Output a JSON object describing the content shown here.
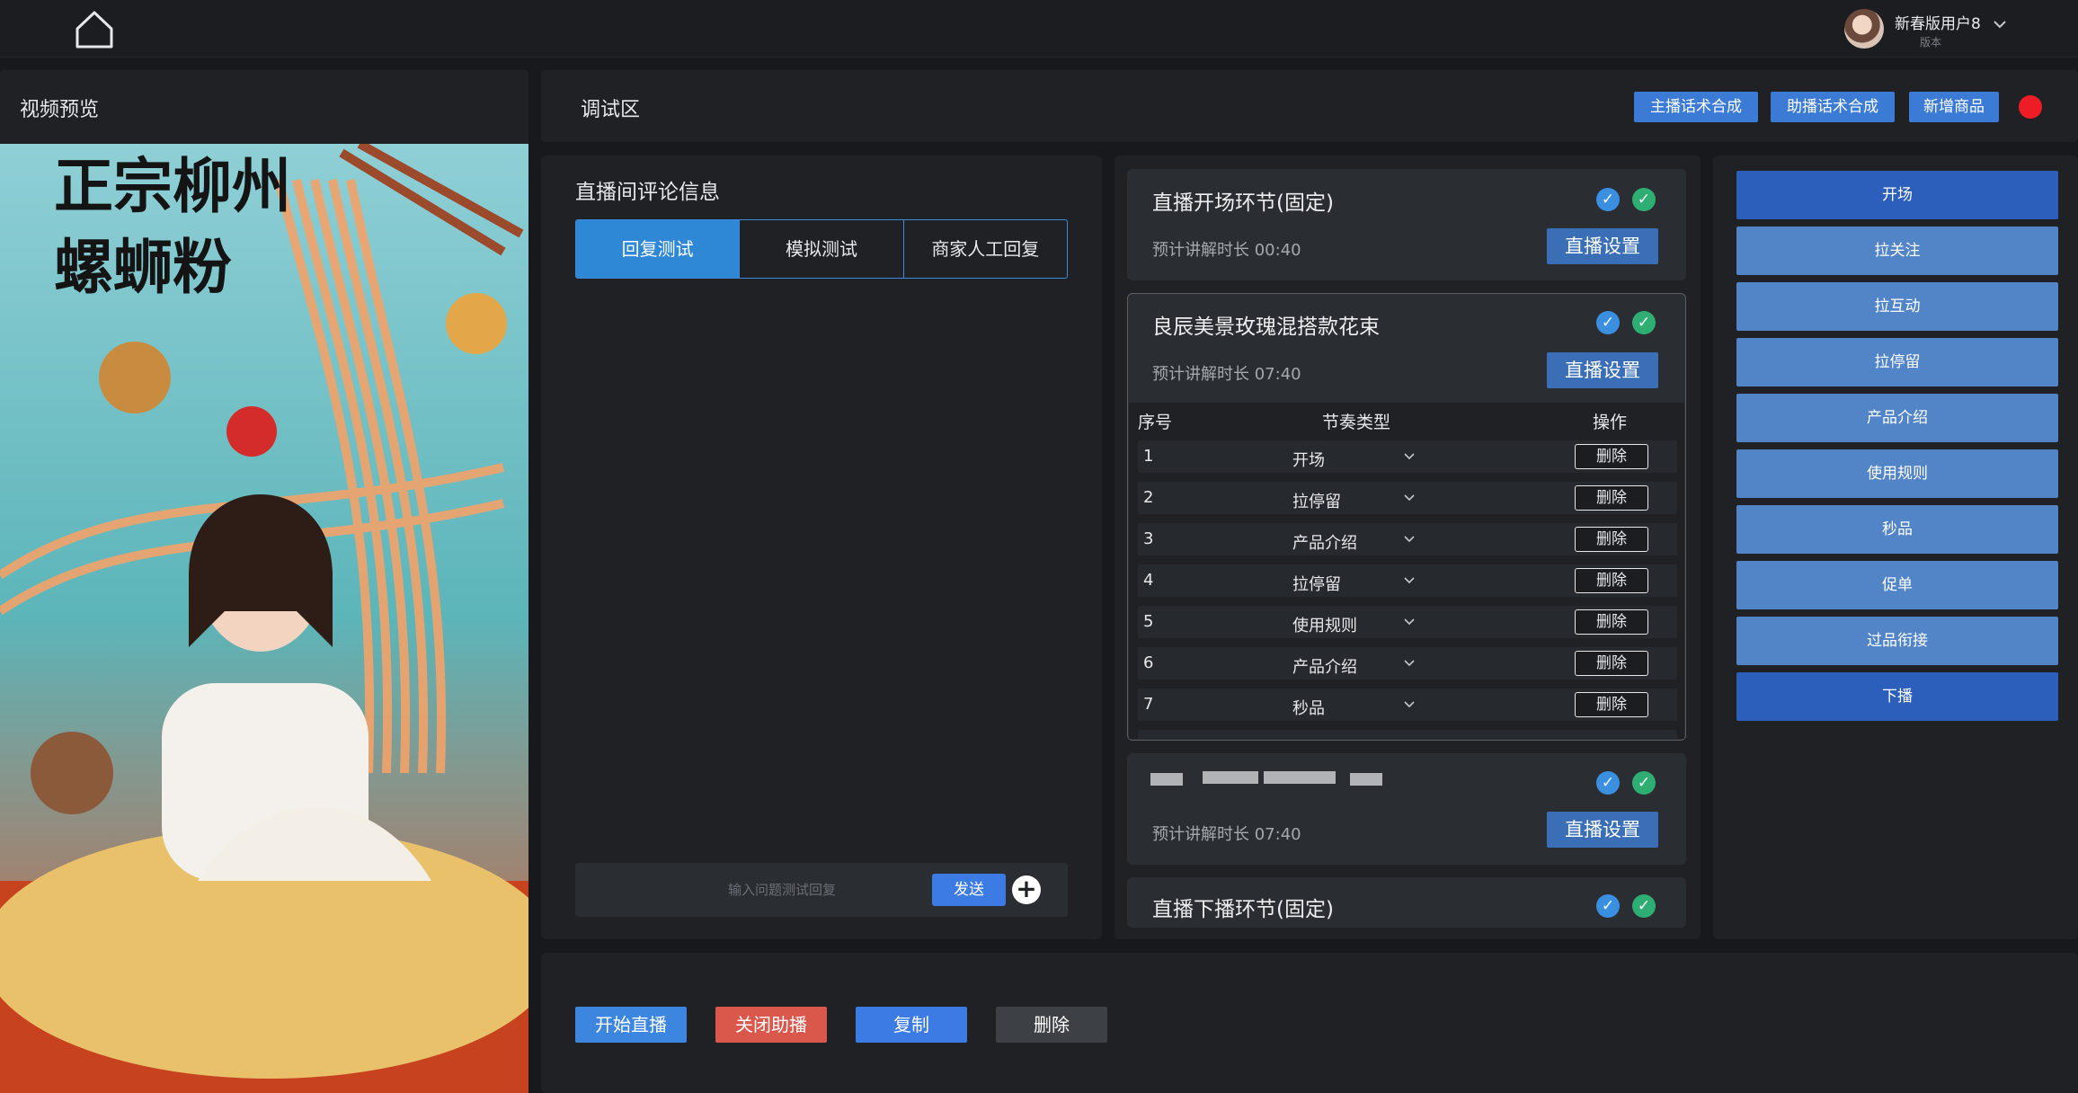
{
  "user": {
    "name": "新春版用户8",
    "sub": "版本"
  },
  "preview": {
    "title": "视频预览",
    "poster_line1": "正宗柳州",
    "poster_line2": "螺蛳粉"
  },
  "debug": {
    "title": "调试区",
    "buttons": [
      "主播话术合成",
      "助播话术合成",
      "新增商品"
    ]
  },
  "comments": {
    "title": "直播间评论信息",
    "tabs": [
      "回复测试",
      "模拟测试",
      "商家人工回复"
    ],
    "input_placeholder": "输入问题测试回复",
    "send_label": "发送"
  },
  "segments": {
    "opening": {
      "title": "直播开场环节(固定)",
      "duration": "预计讲解时长 00:40",
      "button": "直播设置"
    },
    "product": {
      "title": "良辰美景玫瑰混搭款花束",
      "duration": "预计讲解时长 07:40",
      "button": "直播设置"
    },
    "table": {
      "headers": [
        "序号",
        "节奏类型",
        "操作"
      ],
      "rows": [
        {
          "no": "1",
          "type": "开场",
          "action": "删除"
        },
        {
          "no": "2",
          "type": "拉停留",
          "action": "删除"
        },
        {
          "no": "3",
          "type": "产品介绍",
          "action": "删除"
        },
        {
          "no": "4",
          "type": "拉停留",
          "action": "删除"
        },
        {
          "no": "5",
          "type": "使用规则",
          "action": "删除"
        },
        {
          "no": "6",
          "type": "产品介绍",
          "action": "删除"
        },
        {
          "no": "7",
          "type": "秒品",
          "action": "删除"
        }
      ]
    },
    "product2": {
      "duration": "预计讲解时长 07:40",
      "button": "直播设置"
    },
    "closing": {
      "title": "直播下播环节(固定)"
    }
  },
  "rhythm": {
    "items": [
      "开场",
      "拉关注",
      "拉互动",
      "拉停留",
      "产品介绍",
      "使用规则",
      "秒品",
      "促单",
      "过品衔接",
      "下播"
    ]
  },
  "actions": {
    "start_live": "开始直播",
    "close_assist": "关闭助播",
    "copy": "复制",
    "delete": "删除"
  },
  "colors": {
    "accent_blue": "#3b7bd6",
    "active_tab": "#2f88d6",
    "rhythm_light": "#5185c8",
    "rhythm_dark": "#2c5fbc",
    "danger": "#d9574b",
    "record_dot": "#ee1c25"
  }
}
